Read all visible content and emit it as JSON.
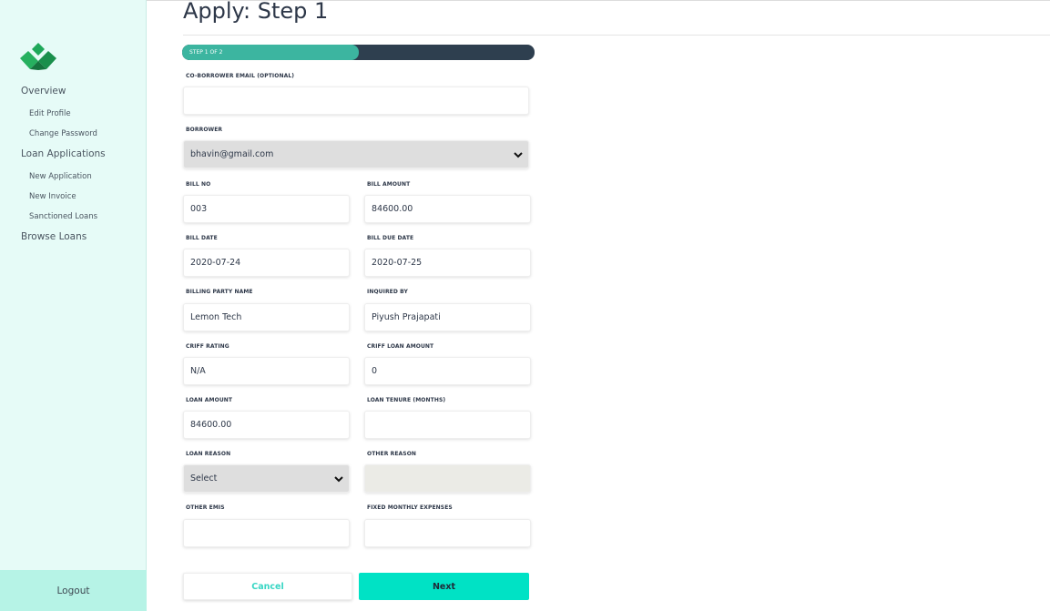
{
  "sidebar": {
    "items": [
      {
        "label": "Overview"
      },
      {
        "label": "Edit Profile"
      },
      {
        "label": "Change Password"
      },
      {
        "label": "Loan Applications"
      },
      {
        "label": "New Application"
      },
      {
        "label": "New Invoice"
      },
      {
        "label": "Sanctioned Loans"
      },
      {
        "label": "Browse Loans"
      }
    ],
    "logout_label": "Logout"
  },
  "page": {
    "title": "Apply: Step 1",
    "progress_label": "STEP 1 OF 2",
    "progress_fraction": 0.5
  },
  "form": {
    "coborrower_email": {
      "label": "CO-BORROWER EMAIL (OPTIONAL)",
      "value": ""
    },
    "borrower": {
      "label": "BORROWER",
      "value": "bhavin@gmail.com"
    },
    "bill_no": {
      "label": "BILL NO",
      "value": "003"
    },
    "bill_amount": {
      "label": "BILL AMOUNT",
      "value": "84600.00"
    },
    "bill_date": {
      "label": "BILL DATE",
      "value": "2020-07-24"
    },
    "bill_due_date": {
      "label": "BILL DUE DATE",
      "value": "2020-07-25"
    },
    "billing_party_name": {
      "label": "BILLING PARTY NAME",
      "value": "Lemon Tech"
    },
    "inquired_by": {
      "label": "INQUIRED BY",
      "value": "Piyush Prajapati"
    },
    "criff_rating": {
      "label": "CRIFF RATING",
      "value": "N/A"
    },
    "criff_loan_amount": {
      "label": "CRIFF LOAN AMOUNT",
      "value": "0"
    },
    "loan_amount": {
      "label": "LOAN AMOUNT",
      "value": "84600.00"
    },
    "loan_tenure": {
      "label": "LOAN TENURE (MONTHS)",
      "value": ""
    },
    "loan_reason": {
      "label": "LOAN REASON",
      "value": "Select"
    },
    "other_reason": {
      "label": "OTHER REASON",
      "value": ""
    },
    "other_emis": {
      "label": "OTHER EMIS",
      "value": ""
    },
    "fixed_monthly_expenses": {
      "label": "FIXED MONTHLY EXPENSES",
      "value": ""
    }
  },
  "buttons": {
    "cancel": "Cancel",
    "next": "Next"
  },
  "colors": {
    "sidebar_bg": "#e6fbf7",
    "accent": "#00e2c5",
    "progress_fill": "#3cb5a0",
    "progress_track": "#2e3f4f"
  }
}
